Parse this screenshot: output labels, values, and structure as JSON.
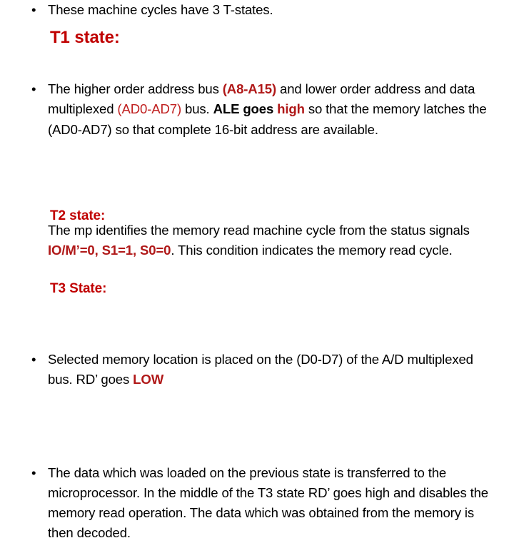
{
  "slide": {
    "background_color": "#FFFFFF",
    "text_color": "#000000",
    "heading_color": "#C00000",
    "accent_bold_red": "#B01818",
    "accent_red": "#C02020",
    "bullet_glyph": "•"
  },
  "content": {
    "intro": {
      "bullet": "•",
      "text": "These machine cycles have 3 T-states."
    },
    "t1_heading": "T1 state:",
    "t1_body": {
      "bullet": "•",
      "run1": "The higher order address bus ",
      "run2": "(A8-A15)",
      "run3": " and lower order address and data multiplexed ",
      "run4": "(AD0-AD7)",
      "run5": " bus. ",
      "run6": "ALE goes ",
      "run7": "high",
      "run8": " so that the memory latches the (AD0-AD7) so that complete 16-bit address are available."
    },
    "t1_status": {
      "run1": "The mp identifies the memory read machine cycle from the status signals ",
      "run2": "IO/M’=0, S1=1, S0=0",
      "run3": ". This condition indicates the memory read cycle."
    },
    "t2_heading": "T2 state:",
    "t2_body": {
      "bullet": "•",
      "run1": "Selected memory location is placed on the (D0-D7) of the A/D multiplexed bus. RD’ goes ",
      "run2": "LOW"
    },
    "t3_heading": "T3 State:",
    "t3_body": {
      "bullet": "•",
      "run1": "The data which was loaded on the previous state is transferred to the microprocessor. In the middle of the T3 state RD’ goes high and disables the memory read operation. The data which was obtained from the memory is then decoded."
    }
  }
}
